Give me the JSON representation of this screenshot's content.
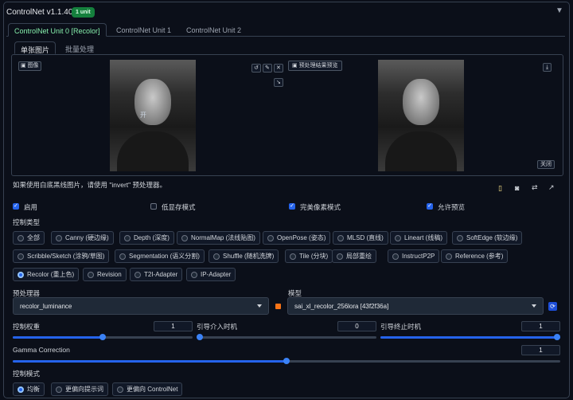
{
  "header": {
    "title": "ControlNet v1.1.406",
    "badge": "1 unit",
    "collapse_icon": "▼"
  },
  "tabs": [
    "ControlNet Unit 0 [Recolor]",
    "ControlNet Unit 1",
    "ControlNet Unit 2"
  ],
  "subtabs": [
    "单张图片",
    "批量处理"
  ],
  "image_panel": {
    "image_label": "图像",
    "preview_label": "预处理结果预览",
    "overlay_text": "开",
    "close_label": "关闭"
  },
  "hint": "如果使用白底黑线图片，请使用 \"invert\" 预处理器。",
  "checkboxes": [
    {
      "label": "启用",
      "checked": true
    },
    {
      "label": "低显存模式",
      "checked": false
    },
    {
      "label": "完美像素模式",
      "checked": true
    },
    {
      "label": "允许预览",
      "checked": true
    }
  ],
  "control_type": {
    "label": "控制类型",
    "options": [
      "全部",
      "Canny (硬边缘)",
      "Depth (深度)",
      "NormalMap (法线贴图)",
      "OpenPose (姿态)",
      "MLSD (直线)",
      "Lineart (线稿)",
      "SoftEdge (软边缘)",
      "Scribble/Sketch (涂鸦/草图)",
      "Segmentation (语义分割)",
      "Shuffle (随机洗牌)",
      "Tile (分块)",
      "局部重绘",
      "InstructP2P",
      "Reference (参考)",
      "Recolor (重上色)",
      "Revision",
      "T2I-Adapter",
      "IP-Adapter"
    ],
    "selected": "Recolor (重上色)"
  },
  "preprocessor": {
    "label": "预处理器",
    "value": "recolor_luminance"
  },
  "model": {
    "label": "模型",
    "value": "sai_xl_recolor_256lora [43f2f36a]"
  },
  "sliders": {
    "weight": {
      "label": "控制权重",
      "value": "1",
      "fraction": 0.5
    },
    "start": {
      "label": "引导介入时机",
      "value": "0",
      "fraction": 0.0
    },
    "end": {
      "label": "引导终止时机",
      "value": "1",
      "fraction": 1.0
    },
    "gamma": {
      "label": "Gamma Correction",
      "value": "1",
      "fraction": 0.5
    }
  },
  "control_mode": {
    "label": "控制模式",
    "options": [
      "均衡",
      "更偏向提示词",
      "更偏向 ControlNet"
    ],
    "selected": "均衡"
  },
  "colors": {
    "accent": "#2563eb",
    "badge": "#15803d",
    "active_tab": "#86efac"
  }
}
